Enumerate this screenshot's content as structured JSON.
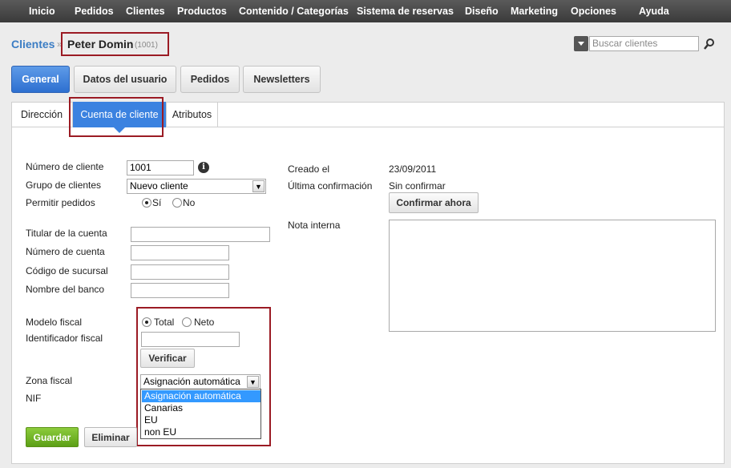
{
  "topnav": [
    "Inicio",
    "Pedidos",
    "Clientes",
    "Productos",
    "Contenido / Categorías",
    "Sistema de reservas",
    "Diseño",
    "Marketing",
    "Opciones",
    "Ayuda"
  ],
  "breadcrumb": {
    "section": "Clientes",
    "sep": "»",
    "name": "Peter Domin",
    "id": "(1001)"
  },
  "search": {
    "placeholder": "Buscar clientes",
    "icon": "search-icon"
  },
  "tabs": [
    "General",
    "Datos del usuario",
    "Pedidos",
    "Newsletters"
  ],
  "subtabs": [
    "Dirección",
    "Cuenta de cliente",
    "Atributos"
  ],
  "form": {
    "customer_number": {
      "label": "Número de cliente",
      "value": "1001",
      "icon": "info-icon"
    },
    "customer_group": {
      "label": "Grupo de clientes",
      "value": "Nuevo cliente"
    },
    "allow_orders": {
      "label": "Permitir pedidos",
      "yes": "Sí",
      "no": "No",
      "selected": "yes"
    },
    "account_holder": {
      "label": "Titular de la cuenta",
      "value": ""
    },
    "account_number": {
      "label": "Número de cuenta",
      "value": ""
    },
    "branch_code": {
      "label": "Código de sucursal",
      "value": ""
    },
    "bank_name": {
      "label": "Nombre del banco",
      "value": ""
    },
    "tax_model": {
      "label": "Modelo fiscal",
      "total": "Total",
      "net": "Neto",
      "selected": "total"
    },
    "tax_id": {
      "label": "Identificador fiscal",
      "value": "",
      "verify": "Verificar"
    },
    "tax_zone": {
      "label": "Zona fiscal",
      "value": "Asignación automática",
      "options": [
        "Asignación automática",
        "Canarias",
        "EU",
        "non EU"
      ]
    },
    "nif": {
      "label": "NIF"
    },
    "created": {
      "label": "Creado el",
      "value": "23/09/2011"
    },
    "last_confirm": {
      "label": "Última confirmación",
      "value": "Sin confirmar",
      "button": "Confirmar ahora"
    },
    "note": {
      "label": "Nota interna",
      "value": ""
    }
  },
  "actions": {
    "save": "Guardar",
    "delete": "Eliminar"
  },
  "colors": {
    "accent": "#3b82e0",
    "highlight": "#9b1b24",
    "save": "#6aad22"
  }
}
